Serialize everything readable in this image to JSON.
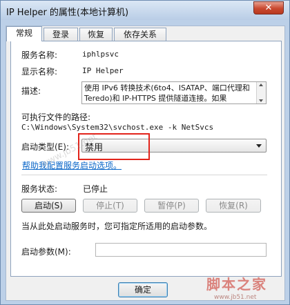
{
  "window": {
    "title": "IP Helper 的属性(本地计算机)",
    "close_glyph": "✕"
  },
  "tabs": [
    {
      "label": "常规",
      "active": true
    },
    {
      "label": "登录",
      "active": false
    },
    {
      "label": "恢复",
      "active": false
    },
    {
      "label": "依存关系",
      "active": false
    }
  ],
  "general": {
    "service_name_label": "服务名称:",
    "service_name_value": "iphlpsvc",
    "display_name_label": "显示名称:",
    "display_name_value": "IP Helper",
    "description_label": "描述:",
    "description_value": "使用 IPv6 转换技术(6to4、ISATAP、端口代理和 Teredo)和 IP-HTTPS 提供隧道连接。如果",
    "path_label": "可执行文件的路径:",
    "path_value": "C:\\Windows\\System32\\svchost.exe -k NetSvcs",
    "startup_type_label": "启动类型(E):",
    "startup_type_value": "禁用",
    "help_link": "帮助我配置服务启动选项。",
    "status_label": "服务状态:",
    "status_value": "已停止",
    "hint_text": "当从此处启动服务时，您可指定所适用的启动参数。",
    "params_label": "启动参数(M):",
    "params_value": ""
  },
  "buttons": {
    "start": "启动(S)",
    "stop": "停止(T)",
    "pause": "暂停(P)",
    "resume": "恢复(R)",
    "ok": "确定"
  },
  "watermark": {
    "logo_text": "脚本之家",
    "url_text": "www.jb51.net",
    "diagonal_text": "www.jb51.net"
  },
  "colors": {
    "title_bg": "#c5d7ee",
    "close_red": "#c9482f",
    "highlight_red": "#e2231a",
    "link_blue": "#0a66c8"
  }
}
